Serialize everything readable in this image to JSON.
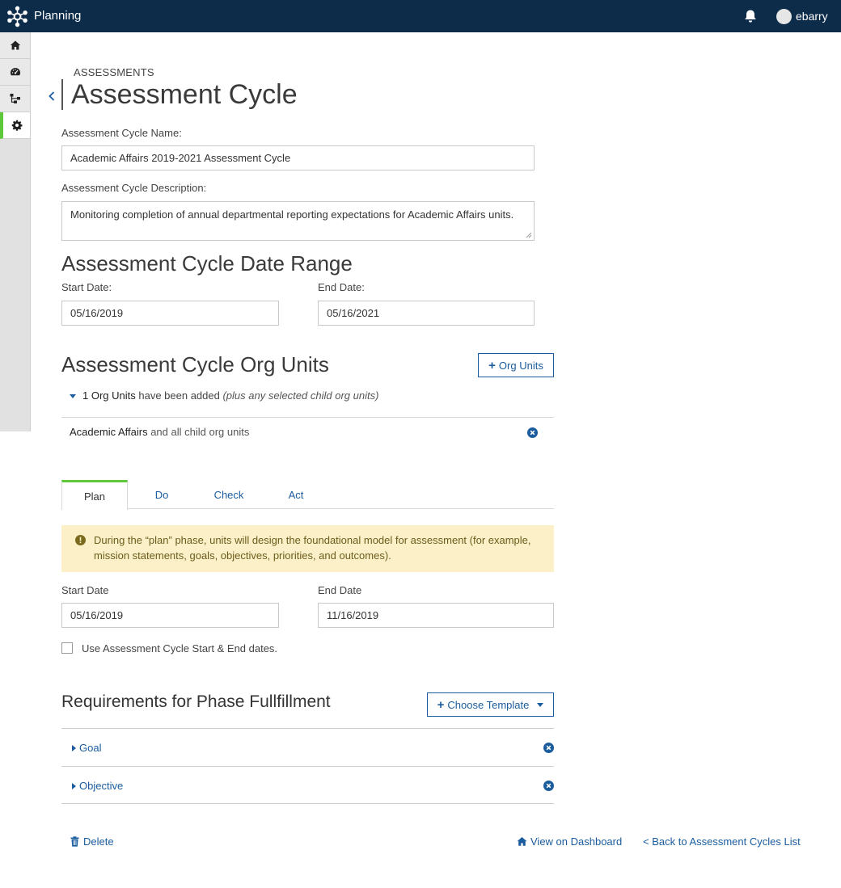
{
  "app": {
    "title": "Planning",
    "username": "ebarry"
  },
  "sidebar": {
    "items": [
      {
        "icon": "home-icon"
      },
      {
        "icon": "dashboard-icon"
      },
      {
        "icon": "org-chart-icon"
      },
      {
        "icon": "gear-icon",
        "active": true
      }
    ]
  },
  "header": {
    "breadcrumb": "ASSESSMENTS",
    "title": "Assessment Cycle"
  },
  "form": {
    "name_label": "Assessment Cycle Name:",
    "name_value": "Academic Affairs 2019-2021 Assessment Cycle",
    "description_label": "Assessment Cycle Description:",
    "description_value": "Monitoring completion of annual departmental reporting expectations for Academic Affairs units."
  },
  "date_range": {
    "heading": "Assessment Cycle Date Range",
    "start_label": "Start Date:",
    "start_value": "05/16/2019",
    "end_label": "End Date:",
    "end_value": "05/16/2021"
  },
  "org_units": {
    "heading": "Assessment Cycle Org Units",
    "add_button": "Org Units",
    "summary_count": "1 Org Units",
    "summary_text": " have been added ",
    "summary_note": "(plus any selected child org units)",
    "rows": [
      {
        "name": "Academic Affairs",
        "suffix": " and all child org units"
      }
    ]
  },
  "phase_tabs": [
    {
      "label": "Plan",
      "active": true
    },
    {
      "label": "Do"
    },
    {
      "label": "Check"
    },
    {
      "label": "Act"
    }
  ],
  "phase": {
    "alert": "During the “plan” phase, units will design the foundational model for assessment (for example, mission statements, goals, objectives, priorities, and outcomes).",
    "start_label": "Start Date",
    "start_value": "05/16/2019",
    "end_label": "End Date",
    "end_value": "11/16/2019",
    "use_cycle_dates_label": "Use Assessment Cycle Start & End dates.",
    "use_cycle_dates_checked": false
  },
  "requirements": {
    "heading": "Requirements for Phase Fullfillment",
    "template_button": "Choose Template",
    "items": [
      {
        "label": "Goal"
      },
      {
        "label": "Objective"
      }
    ]
  },
  "footer": {
    "delete": "Delete",
    "view_dashboard": "View on Dashboard",
    "back_to_list": "< Back to Assessment Cycles List"
  },
  "colors": {
    "topbar": "#0d2c4a",
    "link": "#1a5c9e",
    "accent_green": "#5ec73a",
    "alert_bg": "#fbf0c8"
  }
}
